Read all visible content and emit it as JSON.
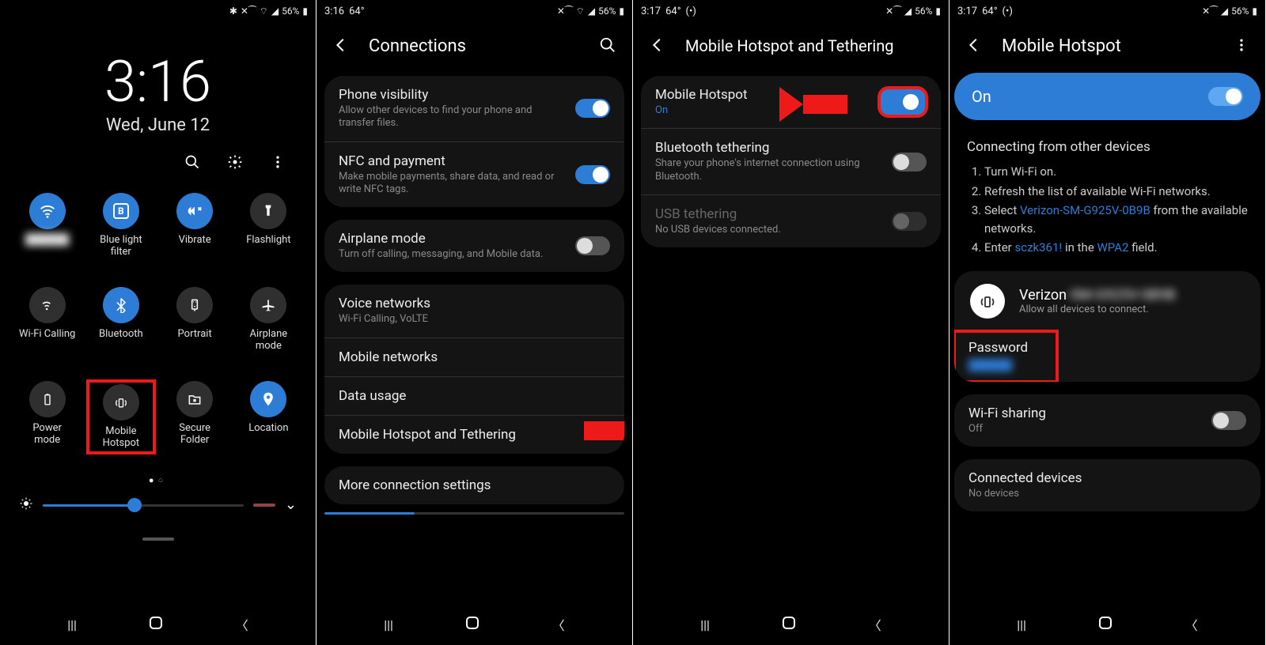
{
  "status": {
    "time1": "",
    "time2": "3:16",
    "time3": "3:17",
    "time4": "3:17",
    "temp": "64°",
    "signal": "56%",
    "hotspot_icon": "(•)"
  },
  "panel1": {
    "clock_time": "3:16",
    "clock_date": "Wed, June 12",
    "tiles": [
      {
        "label": "██████",
        "active": true
      },
      {
        "label": "Blue light\nfilter",
        "active": true
      },
      {
        "label": "Vibrate",
        "active": true
      },
      {
        "label": "Flashlight",
        "active": false
      },
      {
        "label": "Wi-Fi Calling",
        "active": false
      },
      {
        "label": "Bluetooth",
        "active": true
      },
      {
        "label": "Portrait",
        "active": false
      },
      {
        "label": "Airplane\nmode",
        "active": false
      },
      {
        "label": "Power\nmode",
        "active": false
      },
      {
        "label": "Mobile\nHotspot",
        "active": false
      },
      {
        "label": "Secure\nFolder",
        "active": false
      },
      {
        "label": "Location",
        "active": true
      }
    ]
  },
  "panel2": {
    "title": "Connections",
    "rows": {
      "phone_vis": {
        "t": "Phone visibility",
        "s": "Allow other devices to find your phone and transfer files.",
        "on": true
      },
      "nfc": {
        "t": "NFC and payment",
        "s": "Make mobile payments, share data, and read or write NFC tags.",
        "on": true
      },
      "airplane": {
        "t": "Airplane mode",
        "s": "Turn off calling, messaging, and Mobile data.",
        "on": false
      },
      "voice": {
        "t": "Voice networks",
        "s": "Wi-Fi Calling, VoLTE"
      },
      "mobile_net": {
        "t": "Mobile networks"
      },
      "data": {
        "t": "Data usage"
      },
      "hotspot": {
        "t": "Mobile Hotspot and Tethering"
      },
      "more": {
        "t": "More connection settings"
      }
    }
  },
  "panel3": {
    "title": "Mobile Hotspot and Tethering",
    "hotspot": {
      "t": "Mobile Hotspot",
      "s": "On"
    },
    "bt": {
      "t": "Bluetooth tethering",
      "s": "Share your phone's internet connection using Bluetooth.",
      "on": false
    },
    "usb": {
      "t": "USB tethering",
      "s": "No USB devices connected.",
      "on": false
    }
  },
  "panel4": {
    "title": "Mobile Hotspot",
    "on_label": "On",
    "conn_heading": "Connecting from other devices",
    "steps": {
      "s1": "Turn Wi-Fi on.",
      "s2": "Refresh the list of available Wi-Fi networks.",
      "s3a": "Select ",
      "s3link": "Verizon-SM-G925V-0B9B",
      "s3b": " from the available networks.",
      "s4a": "Enter ",
      "s4pwd": "sczk361!",
      "s4b": " in the ",
      "s4wpa": "WPA2",
      "s4c": " field."
    },
    "ssid_label": "Verizon",
    "ssid_sub": "Allow all devices to connect.",
    "password_t": "Password",
    "password_v": "██████",
    "wifi_sharing_t": "Wi-Fi sharing",
    "wifi_sharing_s": "Off",
    "connected_t": "Connected devices",
    "connected_s": "No devices"
  }
}
